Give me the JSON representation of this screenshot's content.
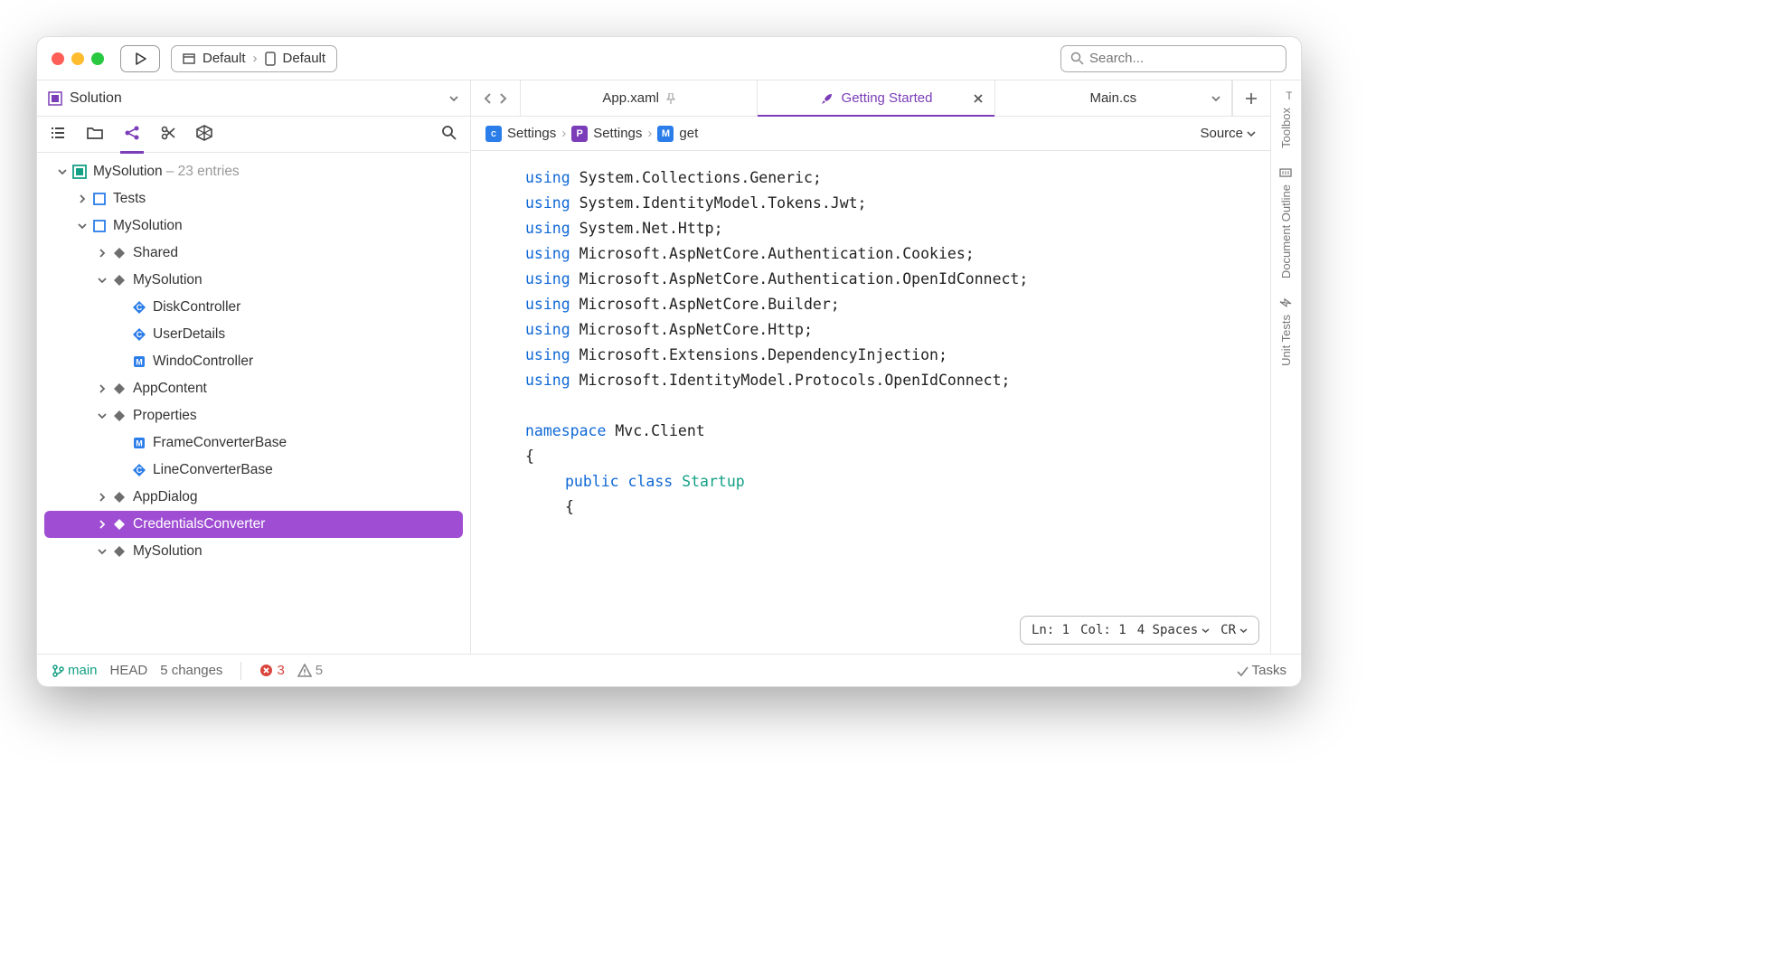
{
  "toolbar": {
    "config": "Default",
    "target": "Default",
    "search_placeholder": "Search..."
  },
  "sidebar": {
    "title": "Solution",
    "root": {
      "name": "MySolution",
      "subtitle": "– 23 entries"
    },
    "nodes": [
      {
        "depth": 0,
        "expand": "down",
        "icon": "solution",
        "name": "MySolution",
        "subtitle": "– 23 entries"
      },
      {
        "depth": 1,
        "expand": "right",
        "icon": "csproj",
        "name": "Tests"
      },
      {
        "depth": 1,
        "expand": "down",
        "icon": "csproj",
        "name": "MySolution"
      },
      {
        "depth": 2,
        "expand": "right",
        "icon": "diamond",
        "name": "Shared"
      },
      {
        "depth": 2,
        "expand": "down",
        "icon": "diamond",
        "name": "MySolution"
      },
      {
        "depth": 3,
        "expand": "none",
        "icon": "cfile",
        "name": "DiskController"
      },
      {
        "depth": 3,
        "expand": "none",
        "icon": "cfile",
        "name": "UserDetails"
      },
      {
        "depth": 3,
        "expand": "none",
        "icon": "mfile",
        "name": "WindoController"
      },
      {
        "depth": 2,
        "expand": "right",
        "icon": "diamond",
        "name": "AppContent"
      },
      {
        "depth": 2,
        "expand": "down",
        "icon": "diamond",
        "name": "Properties"
      },
      {
        "depth": 3,
        "expand": "none",
        "icon": "mfile",
        "name": "FrameConverterBase"
      },
      {
        "depth": 3,
        "expand": "none",
        "icon": "cfile",
        "name": "LineConverterBase"
      },
      {
        "depth": 2,
        "expand": "right",
        "icon": "diamond",
        "name": "AppDialog"
      },
      {
        "depth": 2,
        "expand": "right",
        "icon": "diamond",
        "name": "CredentialsConverter",
        "selected": true
      },
      {
        "depth": 2,
        "expand": "down",
        "icon": "diamond",
        "name": "MySolution"
      }
    ]
  },
  "tabs": [
    {
      "label": "App.xaml",
      "pinned": true,
      "active": false,
      "icon": "none"
    },
    {
      "label": "Getting Started",
      "pinned": false,
      "active": true,
      "icon": "rocket",
      "closable": true
    },
    {
      "label": "Main.cs",
      "pinned": false,
      "active": false,
      "icon": "none",
      "dropdown": true
    }
  ],
  "breadcrumbs": {
    "items": [
      {
        "icon": "cfile",
        "label": "Settings"
      },
      {
        "icon": "pfile",
        "label": "Settings"
      },
      {
        "icon": "mfile",
        "label": "get"
      }
    ],
    "source_label": "Source"
  },
  "code": {
    "usings": [
      "System.Collections.Generic",
      "System.IdentityModel.Tokens.Jwt",
      "System.Net.Http",
      "Microsoft.AspNetCore.Authentication.Cookies",
      "Microsoft.AspNetCore.Authentication.OpenIdConnect",
      "Microsoft.AspNetCore.Builder",
      "Microsoft.AspNetCore.Http",
      "Microsoft.Extensions.DependencyInjection",
      "Microsoft.IdentityModel.Protocols.OpenIdConnect"
    ],
    "namespace": "Mvc.Client",
    "class_mod": "public class",
    "class_name": "Startup"
  },
  "editor_status": {
    "ln": "Ln: 1",
    "col": "Col: 1",
    "indent": "4 Spaces",
    "lineend": "CR"
  },
  "rail": {
    "toolbox": "Toolbox",
    "outline": "Document Outline",
    "tests": "Unit Tests"
  },
  "statusbar": {
    "branch": "main",
    "head": "HEAD",
    "changes": "5 changes",
    "errors": "3",
    "warnings": "5",
    "tasks": "Tasks"
  }
}
